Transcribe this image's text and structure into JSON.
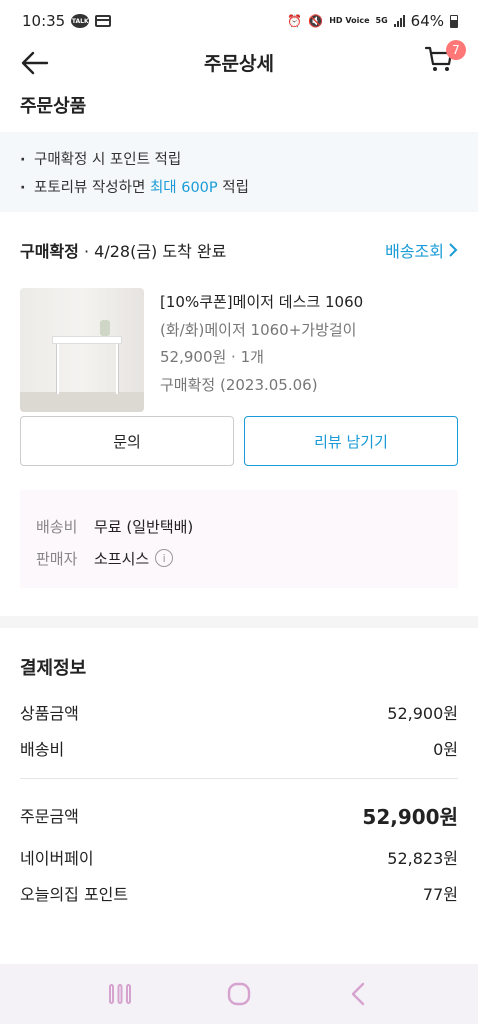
{
  "status_bar": {
    "time": "10:35",
    "talk_icon_text": "TALK",
    "hd_voice": "HD Voice",
    "network": "5G",
    "battery": "64%"
  },
  "header": {
    "title": "주문상세",
    "cart_count": "7"
  },
  "section": {
    "products_title": "주문상품"
  },
  "notice": {
    "line1": "구매확정 시 포인트 적립",
    "line2_prefix": "포토리뷰 작성하면 ",
    "line2_highlight": "최대 600P",
    "line2_suffix": " 적립"
  },
  "order": {
    "status_bold": "구매확정",
    "status_rest": " · 4/28(금) 도착 완료",
    "track_label": "배송조회",
    "product_name": "[10%쿠폰]메이저 데스크 1060",
    "product_option": "(화/화)메이저 1060+가방걸이",
    "price_qty": "52,900원 · 1개",
    "confirm_date": "구매확정 (2023.05.06)"
  },
  "buttons": {
    "inquiry": "문의",
    "review": "리뷰 남기기"
  },
  "shipping": {
    "fee_label": "배송비",
    "fee_value": "무료 (일반택배)",
    "seller_label": "판매자",
    "seller_value": "소프시스"
  },
  "payment": {
    "title": "결제정보",
    "product_amount_label": "상품금액",
    "product_amount": "52,900원",
    "shipping_label": "배송비",
    "shipping_amount": "0원",
    "order_total_label": "주문금액",
    "order_total": "52,900원",
    "naverpay_label": "네이버페이",
    "naverpay_amount": "52,823원",
    "points_label": "오늘의집 포인트",
    "points_amount": "77원"
  },
  "colors": {
    "accent": "#1a9bd7",
    "badge": "#ff7777",
    "nav_bar": "#f4f1f7",
    "nav_icon": "#d6a3cf"
  }
}
